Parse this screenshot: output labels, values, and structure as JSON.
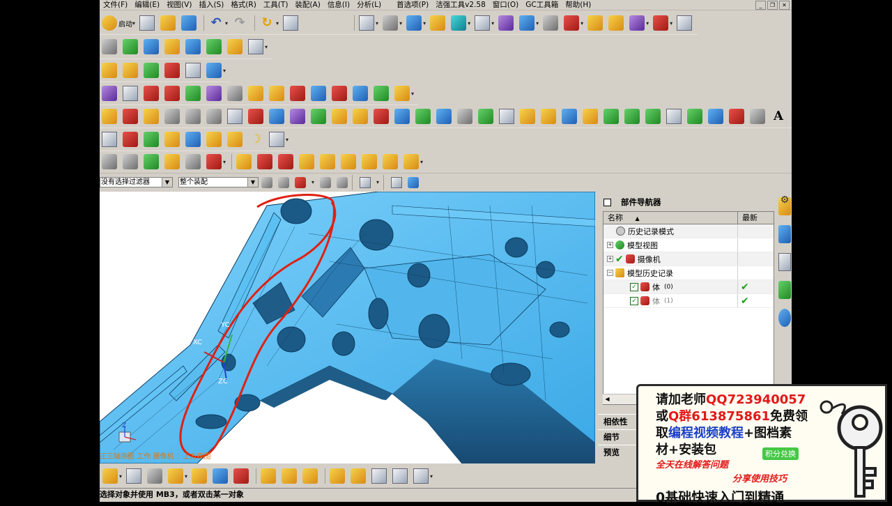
{
  "menu": {
    "items": [
      "文件(F)",
      "编辑(E)",
      "视图(V)",
      "插入(S)",
      "格式(R)",
      "工具(T)",
      "装配(A)",
      "信息(I)",
      "分析(L)",
      "首选项(P)",
      "洁强工具v2.58",
      "窗口(O)",
      "GC工具箱",
      "帮助(H)"
    ]
  },
  "toolbar": {
    "start_label": "启动"
  },
  "filter": {
    "selection_filter": "没有选择过滤器",
    "scope": "整个装配"
  },
  "viewport": {
    "view_label": "正三轴测图 工作 摄像机 ：上方视图",
    "axes": {
      "yc": "YC",
      "xc": "XC",
      "zc": "ZC",
      "z": "Z"
    },
    "colors": {
      "part": "#4db8ef",
      "shadow": "#1f5d88",
      "annotation": "#e02010"
    }
  },
  "navigator": {
    "title": "部件导航器",
    "columns": {
      "name": "名称",
      "latest": "最新"
    },
    "rows": [
      {
        "label": "历史记录模式",
        "latest": ""
      },
      {
        "label": "模型视图",
        "latest": ""
      },
      {
        "label": "摄像机",
        "latest": ""
      },
      {
        "label": "模型历史记录",
        "latest": ""
      },
      {
        "label": "体",
        "count": "(0)",
        "latest": "✔"
      },
      {
        "label": "体",
        "count": "(1)",
        "latest": "✔"
      }
    ],
    "sections": [
      "相依性",
      "细节",
      "预览"
    ]
  },
  "status": {
    "prompt": "选择对象并使用 MB3，或者双击某一对象"
  },
  "promo": {
    "lines": [
      {
        "a": "请加老师",
        "b": "QQ723940057"
      },
      {
        "a": "或",
        "b": "Q群613875861",
        "c": "免费领"
      },
      {
        "a": "取",
        "b": "编程视频教程",
        "c": "+图档素"
      },
      {
        "a": "材+安装包"
      }
    ],
    "stamp": "积分兑换",
    "line_service": "全天在线解答问题",
    "line_tips": "分享使用技巧",
    "line_last": "0基础快速入门到精通"
  }
}
